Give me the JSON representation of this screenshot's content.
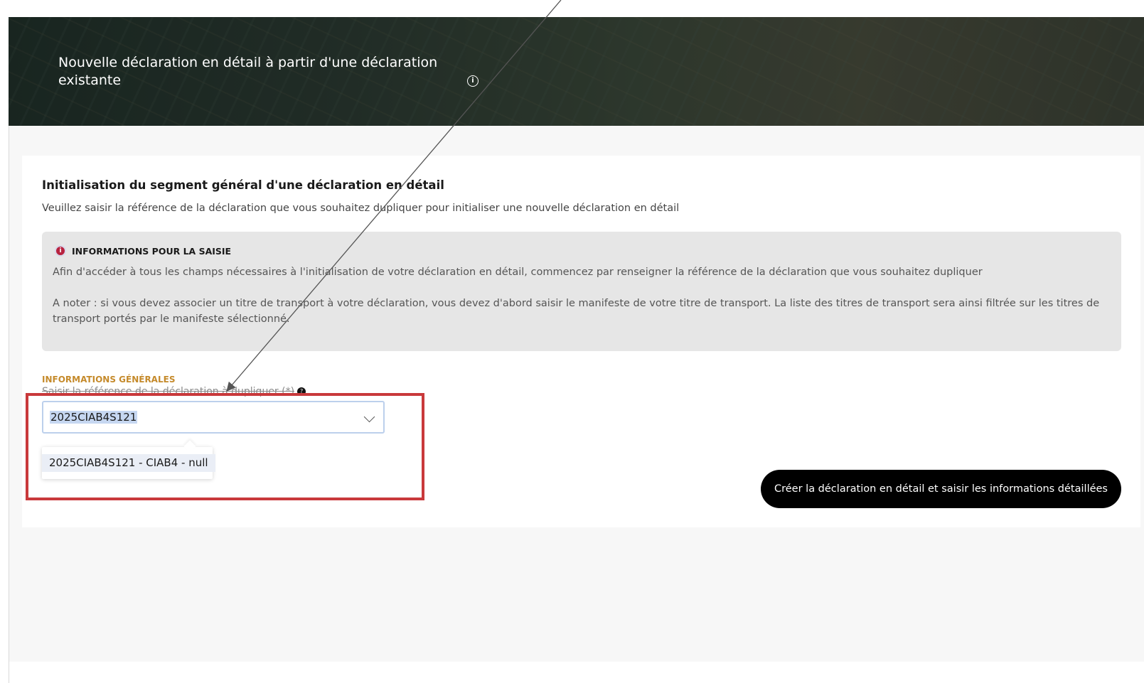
{
  "banner": {
    "title": "Nouvelle déclaration en détail à partir d'une déclaration existante"
  },
  "section": {
    "title": "Initialisation du segment général d'une déclaration en détail",
    "subtitle": "Veuillez saisir la référence de la déclaration que vous souhaitez dupliquer pour initialiser une nouvelle déclaration en détail"
  },
  "info_box": {
    "heading": "INFORMATIONS POUR LA SAISIE",
    "paragraph_1": "Afin d'accéder à tous les champs nécessaires à l'initialisation de votre déclaration en détail, commencez par renseigner la référence de la déclaration que vous souhaitez dupliquer",
    "paragraph_2": "A noter : si vous devez associer un titre de transport à votre déclaration, vous devez d'abord saisir le manifeste de votre titre de transport. La liste des titres de transport sera ainsi filtrée sur les titres de transport portés par le manifeste sélectionné."
  },
  "form": {
    "section_label": "INFORMATIONS GÉNÉRALES",
    "field_label": "Saisir la référence de la déclaration à dupliquer (*)",
    "select_value": "2025CIAB4S121",
    "dropdown_options": [
      "2025CIAB4S121 - CIAB4 - null"
    ]
  },
  "actions": {
    "create_label": "Créer la déclaration en détail et saisir les informations détaillées"
  },
  "icons": {
    "banner_info": "info-circle-icon",
    "info_box": "info-icon",
    "field_help": "help-icon",
    "select": "chevron-down-icon"
  },
  "colors": {
    "accent_label": "#c58a2b",
    "highlight": "#c9393b",
    "button_bg": "#000000"
  }
}
